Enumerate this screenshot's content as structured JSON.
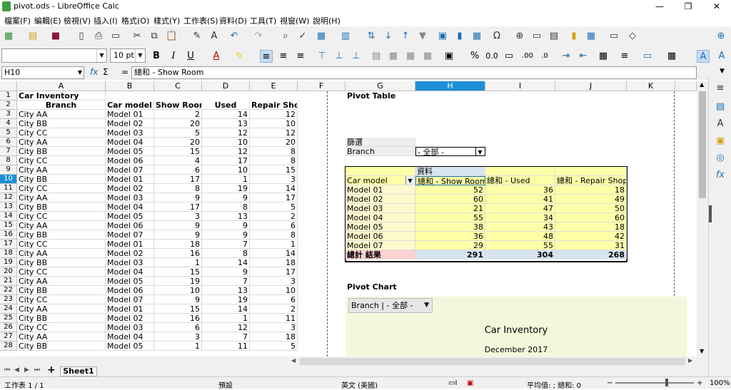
{
  "window": {
    "title": "pivot.ods - LibreOffice Calc",
    "minimize": "—",
    "restore": "❐",
    "close": "✕"
  },
  "menu": [
    "檔案(F)",
    "編輯(E)",
    "檢視(V)",
    "插入(I)",
    "格式(O)",
    "樣式(Y)",
    "工作表(S)",
    "資料(D)",
    "工具(T)",
    "視窗(W)",
    "說明(H)"
  ],
  "format": {
    "font_name": "",
    "font_size": "10 pt"
  },
  "formula": {
    "cell_ref": "H10",
    "content": "總和 - Show Room",
    "fx": "fx",
    "sigma": "Σ",
    "equals": "="
  },
  "columns": [
    "A",
    "B",
    "C",
    "D",
    "E",
    "F",
    "G",
    "H",
    "I",
    "J",
    "K"
  ],
  "rows": [
    "1",
    "2",
    "3",
    "4",
    "5",
    "6",
    "7",
    "8",
    "9",
    "10",
    "11",
    "12",
    "13",
    "14",
    "15",
    "16",
    "17",
    "18",
    "19",
    "20",
    "21",
    "22",
    "23",
    "24",
    "25",
    "26",
    "27",
    "28"
  ],
  "inventory": {
    "title": "Car Inventory",
    "headers": [
      "Branch",
      "Car model",
      "Show Room",
      "Used",
      "Repair Shop"
    ],
    "records": [
      [
        "City AA",
        "Model 01",
        "2",
        "14",
        "12"
      ],
      [
        "City BB",
        "Model 02",
        "20",
        "13",
        "10"
      ],
      [
        "City CC",
        "Model 03",
        "5",
        "12",
        "12"
      ],
      [
        "City AA",
        "Model 04",
        "20",
        "10",
        "20"
      ],
      [
        "City BB",
        "Model 05",
        "15",
        "12",
        "8"
      ],
      [
        "City CC",
        "Model 06",
        "4",
        "17",
        "8"
      ],
      [
        "City AA",
        "Model 07",
        "6",
        "10",
        "15"
      ],
      [
        "City BB",
        "Model 01",
        "17",
        "1",
        "3"
      ],
      [
        "City CC",
        "Model 02",
        "8",
        "19",
        "14"
      ],
      [
        "City AA",
        "Model 03",
        "9",
        "9",
        "17"
      ],
      [
        "City BB",
        "Model 04",
        "17",
        "8",
        "5"
      ],
      [
        "City CC",
        "Model 05",
        "3",
        "13",
        "2"
      ],
      [
        "City AA",
        "Model 06",
        "9",
        "9",
        "6"
      ],
      [
        "City BB",
        "Model 07",
        "9",
        "9",
        "8"
      ],
      [
        "City CC",
        "Model 01",
        "18",
        "7",
        "1"
      ],
      [
        "City AA",
        "Model 02",
        "16",
        "8",
        "14"
      ],
      [
        "City BB",
        "Model 03",
        "1",
        "14",
        "18"
      ],
      [
        "City CC",
        "Model 04",
        "15",
        "9",
        "17"
      ],
      [
        "City AA",
        "Model 05",
        "19",
        "7",
        "3"
      ],
      [
        "City BB",
        "Model 06",
        "10",
        "13",
        "10"
      ],
      [
        "City CC",
        "Model 07",
        "9",
        "19",
        "6"
      ],
      [
        "City AA",
        "Model 01",
        "15",
        "14",
        "2"
      ],
      [
        "City BB",
        "Model 02",
        "16",
        "1",
        "11"
      ],
      [
        "City CC",
        "Model 03",
        "6",
        "12",
        "3"
      ],
      [
        "City AA",
        "Model 04",
        "3",
        "7",
        "18"
      ],
      [
        "City BB",
        "Model 05",
        "1",
        "11",
        "5"
      ]
    ]
  },
  "pivot": {
    "title": "Pivot Table",
    "filter_label": "篩選",
    "filter_field": "Branch",
    "filter_value": "- 全部 -",
    "data_label": "資料",
    "row_field": "Car model",
    "col_headers": [
      "總和 - Show Room",
      "總和 - Used",
      "總和 - Repair Shop"
    ],
    "rows": [
      [
        "Model 01",
        "52",
        "36",
        "18"
      ],
      [
        "Model 02",
        "60",
        "41",
        "49"
      ],
      [
        "Model 03",
        "21",
        "47",
        "50"
      ],
      [
        "Model 04",
        "55",
        "34",
        "60"
      ],
      [
        "Model 05",
        "38",
        "43",
        "18"
      ],
      [
        "Model 06",
        "36",
        "48",
        "42"
      ],
      [
        "Model 07",
        "29",
        "55",
        "31"
      ]
    ],
    "total": [
      "總計 結果",
      "291",
      "304",
      "268"
    ]
  },
  "pivot_chart": {
    "label": "Pivot Chart",
    "filter_button": "Branch | -  全部  -",
    "title": "Car Inventory",
    "subtitle": "December 2017"
  },
  "sheet": {
    "tab": "Sheet1",
    "add": "+"
  },
  "status": {
    "sheet_pos": "工作表 1 / 1",
    "page_style": "預設",
    "language": "英文 (美國)",
    "summary": "平均值: ; 總和: 0",
    "zoom": "100%"
  }
}
